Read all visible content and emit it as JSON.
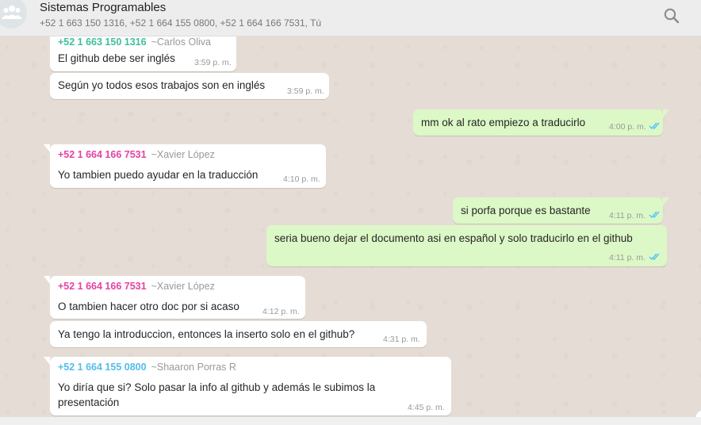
{
  "header": {
    "title": "Sistemas Programables",
    "participants": "+52 1 663 150 1316, +52 1 664 155 0800, +52 1 664 166 7531, Tú",
    "avatar_icon": "group-icon",
    "search_icon": "search-icon"
  },
  "colors": {
    "chat_bg": "#e5ddd5",
    "incoming": "#ffffff",
    "outgoing": "#dcf8c6",
    "sender_green": "#3fbf9b",
    "sender_pink": "#e542a3",
    "sender_blue": "#53bdeb",
    "read_ticks": "#4fc3f7"
  },
  "messages": [
    {
      "sender_number": "+52 1 663 150 1316",
      "sender_name": "~Carlos Oliva",
      "text": "El github debe ser inglés",
      "time": "3:59 p. m."
    },
    {
      "text": "Según yo todos esos trabajos son en inglés",
      "time": "3:59 p. m."
    },
    {
      "text": "mm ok al rato empiezo a traducirlo",
      "time": "4:00 p. m."
    },
    {
      "sender_number": "+52 1 664 166 7531",
      "sender_name": "~Xavier López",
      "text": "Yo tambien puedo ayudar en la traducción",
      "time": "4:10 p. m."
    },
    {
      "text": "si porfa porque es bastante",
      "time": "4:11 p. m."
    },
    {
      "text": "seria bueno dejar el documento asi en español y solo traducirlo en el github",
      "time": "4:11 p. m."
    },
    {
      "sender_number": "+52 1 664 166 7531",
      "sender_name": "~Xavier López",
      "text": "O tambien hacer otro doc por si acaso",
      "time": "4:12 p. m."
    },
    {
      "text": "Ya tengo la introduccion, entonces la inserto solo en el github?",
      "time": "4:31 p. m."
    },
    {
      "sender_number": "+52 1 664 155 0800",
      "sender_name": "~Shaaron Porras R",
      "text": "Yo diría que si? Solo pasar la info al github y además le subimos la presentación",
      "time": "4:45 p. m."
    }
  ]
}
